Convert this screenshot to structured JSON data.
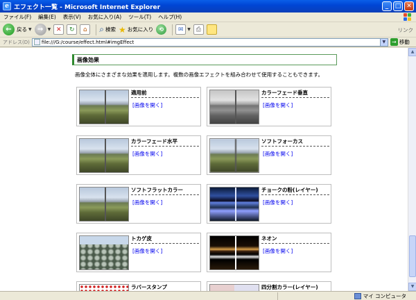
{
  "window": {
    "title": "エフェクト一覧 - Microsoft Internet Explorer",
    "minimize": "_",
    "maximize": "□",
    "close": "✕"
  },
  "menu": [
    "ファイル(F)",
    "編集(E)",
    "表示(V)",
    "お気に入り(A)",
    "ツール(T)",
    "ヘルプ(H)"
  ],
  "toolbar": {
    "back_label": "戻る",
    "search_label": "検索",
    "favorites_label": "お気に入り",
    "links_label": "リンク"
  },
  "address": {
    "label": "アドレス(D)",
    "url": "file:///G:/course/effect.html#imgEffect",
    "go_label": "移動"
  },
  "page": {
    "section_title": "画像効果",
    "description": "画像全体にさまざまな効果を適用します。複数の画像エフェクトを組み合わせて使用することもできます。",
    "open_link_text": "[画像を開く]",
    "cards": [
      {
        "name": "適用前",
        "thumb": "landscape"
      },
      {
        "name": "カラーフェード垂直",
        "thumb": "landscape-gray"
      },
      {
        "name": "カラーフェード水平",
        "thumb": "landscape"
      },
      {
        "name": "ソフトフォーカス",
        "thumb": "landscape"
      },
      {
        "name": "ソフトフラットカラー",
        "thumb": "landscape"
      },
      {
        "name": "チョークの粉(レイヤー)",
        "thumb": "chalk"
      },
      {
        "name": "トカゲ皮",
        "thumb": "lizard"
      },
      {
        "name": "ネオン",
        "thumb": "neon"
      },
      {
        "name": "ラバースタンプ",
        "thumb": "stamp"
      },
      {
        "name": "四分割カラー(レイヤー)",
        "thumb": "quad"
      }
    ]
  },
  "status": {
    "zone_label": "マイ コンピュータ"
  }
}
